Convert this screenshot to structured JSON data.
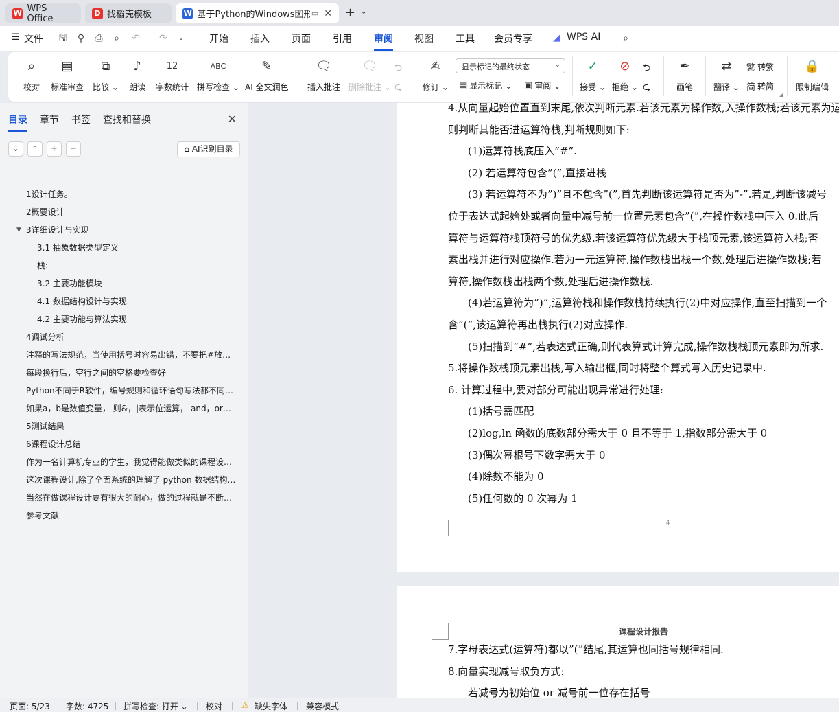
{
  "tabs": [
    {
      "label": "WPS Office",
      "icon": "wps-logo-icon"
    },
    {
      "label": "找稻壳模板",
      "icon": "docer-icon"
    },
    {
      "label": "基于Python的Windows图形",
      "icon": "word-doc-icon"
    }
  ],
  "menu": {
    "file": "文件",
    "items": [
      "开始",
      "插入",
      "页面",
      "引用",
      "审阅",
      "视图",
      "工具",
      "会员专享"
    ],
    "active": "审阅",
    "ai": "WPS AI"
  },
  "ribbon": {
    "proofread": "校对",
    "standard_review": "标准审查",
    "compare": "比较",
    "read_aloud": "朗读",
    "word_count": "字数统计",
    "spell_check": "拼写检查",
    "ai_polish": "AI 全文润色",
    "insert_comment": "插入批注",
    "delete_comment": "删除批注",
    "track_changes": "修订",
    "show_markup_select": "显示标记的最终状态",
    "show_markup": "显示标记",
    "review": "审阅",
    "accept": "接受",
    "reject": "拒绝",
    "pen": "画笔",
    "translate": "翻译",
    "to_traditional": "转繁",
    "to_simplified": "转简",
    "restrict_edit": "限制编辑"
  },
  "sidebar": {
    "tabs": [
      "目录",
      "章节",
      "书签",
      "查找和替换"
    ],
    "ai_toc": "AI识别目录",
    "toc": [
      {
        "text": "1设计任务。",
        "level": 1
      },
      {
        "text": "2概要设计",
        "level": 1
      },
      {
        "text": "3详细设计与实现",
        "level": 1,
        "expanded": true
      },
      {
        "text": "3.1 抽象数据类型定义",
        "level": 2
      },
      {
        "text": "栈:",
        "level": 2
      },
      {
        "text": "3.2  主要功能模块",
        "level": 2
      },
      {
        "text": "4.1  数据结构设计与实现",
        "level": 2
      },
      {
        "text": "4.2  主要功能与算法实现",
        "level": 2
      },
      {
        "text": "4调试分析",
        "level": 1
      },
      {
        "text": "注释的写法规范，当使用括号时容易出错，不要把#放在括号里面",
        "level": 1
      },
      {
        "text": "每段换行后，空行之间的空格要检查好",
        "level": 1
      },
      {
        "text": "Python不同于R软件，编号规则和循环语句写法都不同，容易混淆",
        "level": 1
      },
      {
        "text": "如果a，b是数值变量，  则&，|表示位运算，  and，or则表示逻辑运算",
        "level": 1
      },
      {
        "text": "5测试结果",
        "level": 1
      },
      {
        "text": "6课程设计总结",
        "level": 1
      },
      {
        "text": "作为一名计算机专业的学生，我觉得能做类似的课程设计是十分有意义的",
        "level": 1
      },
      {
        "text": "这次课程设计,除了全面系统的理解了 python 数据结构的一般原理",
        "level": 1
      },
      {
        "text": "当然在做课程设计要有很大的耐心，做的过程就是不断调试的过程",
        "level": 1
      },
      {
        "text": "参考文献",
        "level": 1
      }
    ]
  },
  "document": {
    "page1_lines": [
      "4.从向量起始位置直到末尾,依次判断元素.若该元素为操作数,入操作数栈;若该元素为运",
      "则判断其能否进运算符栈,判断规则如下:",
      "(1)运算符栈底压入”#”.",
      "(2)  若运算符包含”(”,直接进栈",
      "(3)  若运算符不为”)”且不包含”(”,首先判断该运算符是否为”-”.若是,判断该减号",
      "位于表达式起始处或者向量中减号前一位置元素包含”(”,在操作数栈中压入 0.此后",
      "算符与运算符栈顶符号的优先级.若该运算符优先级大于栈顶元素,该运算符入栈;否",
      "素出栈并进行对应操作.若为一元运算符,操作数栈出栈一个数,处理后进操作数栈;若",
      "算符,操作数栈出栈两个数,处理后进操作数栈.",
      "(4)若运算符为”)”,运算符栈和操作数栈持续执行(2)中对应操作,直至扫描到一个",
      "含”(”,该运算符再出栈执行(2)对应操作.",
      "(5)扫描到”#”,若表达式正确,则代表算式计算完成,操作数栈栈顶元素即为所求.",
      "5.将操作数栈顶元素出栈,写入输出框,同时将整个算式写入历史记录中.",
      "6.  计算过程中,要对部分可能出现异常进行处理:",
      "(1)括号需匹配",
      "(2)log,ln 函数的底数部分需大于 0 且不等于 1,指数部分需大于 0",
      "(3)偶次幂根号下数字需大于 0",
      "(4)除数不能为 0",
      "(5)任何数的 0 次幂为 1"
    ],
    "page_number": "4",
    "page2_header": "课程设计报告",
    "page2_lines": [
      "7.字母表达式(运算符)都以”(”结尾,其运算也同括号规律相同.",
      "8.向量实现减号取负方式:",
      "若减号为初始位 or 减号前一位存在括号"
    ]
  },
  "status": {
    "page": "页面: 5/23",
    "words": "字数: 4725",
    "spell": "拼写检查: 打开",
    "proof": "校对",
    "missing_font": "缺失字体",
    "compat": "兼容模式"
  },
  "colors": {
    "accent": "#1a56d6",
    "wps_red": "#e8322d"
  }
}
